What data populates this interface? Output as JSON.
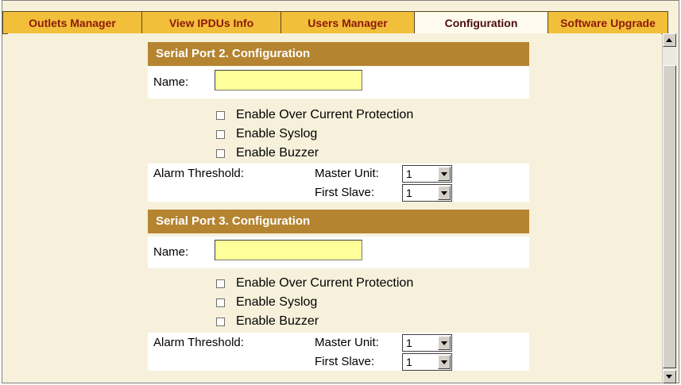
{
  "tabs": [
    {
      "label": "Outlets Manager",
      "active": false
    },
    {
      "label": "View IPDUs Info",
      "active": false
    },
    {
      "label": "Users Manager",
      "active": false
    },
    {
      "label": "Configuration",
      "active": true
    },
    {
      "label": "Software Upgrade",
      "active": false
    }
  ],
  "ports": [
    {
      "header": "Serial Port 2. Configuration",
      "name_label": "Name:",
      "name_value": "",
      "checks": [
        {
          "label": "Enable Over Current Protection",
          "checked": false
        },
        {
          "label": "Enable Syslog",
          "checked": false
        },
        {
          "label": "Enable Buzzer",
          "checked": false
        }
      ],
      "alarm_label": "Alarm Threshold:",
      "master_label": "Master Unit:",
      "master_value": "1",
      "slave_label": "First Slave:",
      "slave_value": "1"
    },
    {
      "header": "Serial Port 3. Configuration",
      "name_label": "Name:",
      "name_value": "",
      "checks": [
        {
          "label": "Enable Over Current Protection",
          "checked": false
        },
        {
          "label": "Enable Syslog",
          "checked": false
        },
        {
          "label": "Enable Buzzer",
          "checked": false
        }
      ],
      "alarm_label": "Alarm Threshold:",
      "master_label": "Master Unit:",
      "master_value": "1",
      "slave_label": "First Slave:",
      "slave_value": "1"
    }
  ],
  "colors": {
    "tab_bg": "#f2bf3a",
    "tab_text": "#8b1a0a",
    "header_bg": "#b58430",
    "input_bg": "#ffff99",
    "page_bg": "#f7f1dc"
  }
}
